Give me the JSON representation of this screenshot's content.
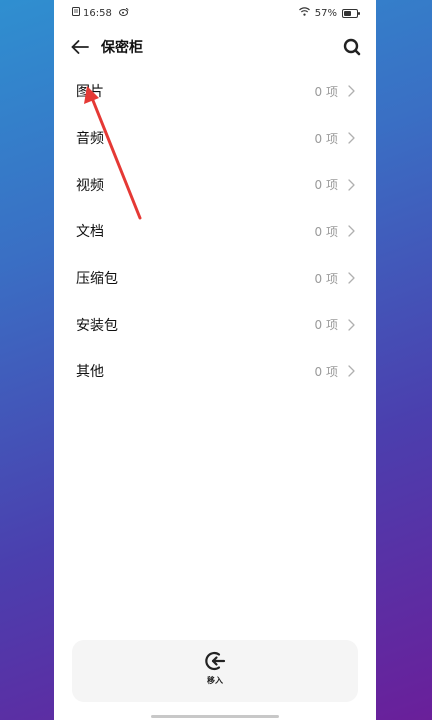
{
  "status_bar": {
    "time": "16:58",
    "battery_percent": "57%",
    "battery_level": 0.57,
    "left_icons": [
      "document-icon",
      "weibo-icon"
    ],
    "right_icons": [
      "wifi-icon",
      "battery-icon"
    ]
  },
  "header": {
    "title": "保密柜",
    "back_icon": "arrow-left-icon",
    "search_icon": "search-icon"
  },
  "categories": [
    {
      "label": "图片",
      "count": "0 项"
    },
    {
      "label": "音频",
      "count": "0 项"
    },
    {
      "label": "视频",
      "count": "0 项"
    },
    {
      "label": "文档",
      "count": "0 项"
    },
    {
      "label": "压缩包",
      "count": "0 项"
    },
    {
      "label": "安装包",
      "count": "0 项"
    },
    {
      "label": "其他",
      "count": "0 项"
    }
  ],
  "bottom_bar": {
    "move_in_label": "移入",
    "move_in_icon": "move-in-icon"
  },
  "colors": {
    "background_top": "#2f8fd0",
    "background_bottom": "#6a1f9a",
    "annotation_arrow": "#e53935",
    "secondary_text": "#9a9a9a"
  }
}
